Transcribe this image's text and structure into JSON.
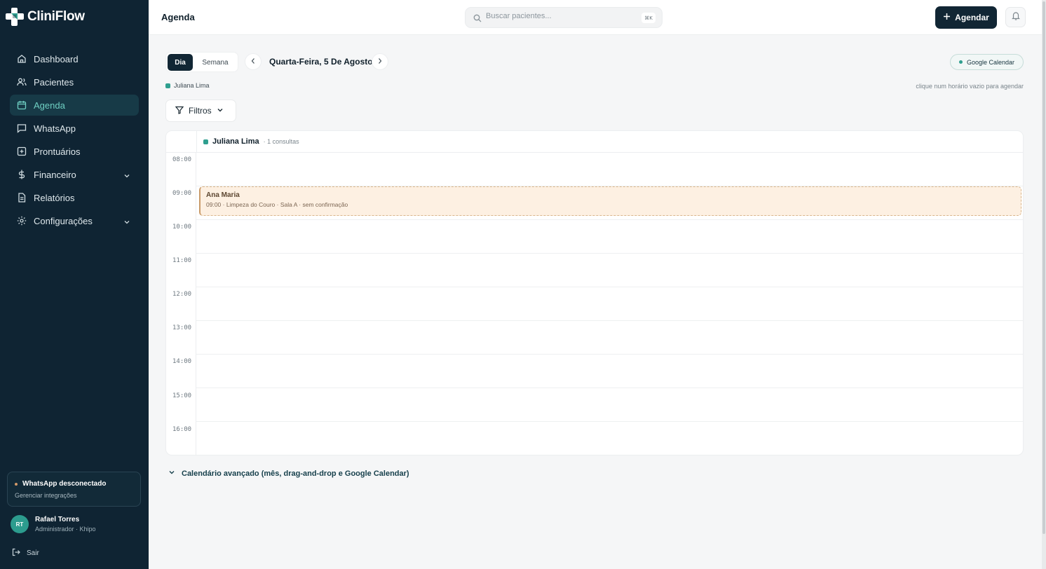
{
  "app": {
    "name": "CliniFlow"
  },
  "sidebar": {
    "items": [
      {
        "label": "Dashboard",
        "icon": "home-icon"
      },
      {
        "label": "Pacientes",
        "icon": "users-icon"
      },
      {
        "label": "Agenda",
        "icon": "calendar-icon",
        "active": true
      },
      {
        "label": "WhatsApp",
        "icon": "chat-icon"
      },
      {
        "label": "Prontuários",
        "icon": "plus-square-icon"
      },
      {
        "label": "Financeiro",
        "icon": "dollar-icon",
        "expandable": true
      },
      {
        "label": "Relatórios",
        "icon": "file-icon"
      },
      {
        "label": "Configurações",
        "icon": "gear-icon",
        "expandable": true
      }
    ],
    "whatsapp_status": {
      "title": "WhatsApp desconectado",
      "link": "Gerenciar integrações"
    },
    "user": {
      "initials": "RT",
      "name": "Rafael Torres",
      "role": "Administrador · Khipo"
    },
    "logout_label": "Sair"
  },
  "header": {
    "title": "Agenda",
    "search_placeholder": "Buscar pacientes...",
    "search_shortcut": "⌘K",
    "primary_button": "Agendar"
  },
  "toolbar": {
    "view_day": "Dia",
    "view_week": "Semana",
    "date": "Quarta-Feira, 5 De Agosto",
    "google_calendar": "Google Calendar",
    "legend_professional": "Juliana Lima",
    "hint": "clique num horário vazio para agendar",
    "filters_label": "Filtros"
  },
  "calendar": {
    "professional": {
      "name": "Juliana Lima",
      "count": "· 1 consultas"
    },
    "hours": [
      "08:00",
      "09:00",
      "10:00",
      "11:00",
      "12:00",
      "13:00",
      "14:00",
      "15:00",
      "16:00"
    ],
    "appointments": [
      {
        "patient": "Ana Maria",
        "detail": "09:00 · Limpeza do Couro · Sala A · sem confirmação",
        "start": "09:00"
      }
    ]
  },
  "advanced_toggle": "Calendário avançado (mês, drag-and-drop e Google Calendar)",
  "colors": {
    "sidebar": "#0f2433",
    "accent": "#2f9f8f",
    "appointment": "#fdf0e2"
  }
}
